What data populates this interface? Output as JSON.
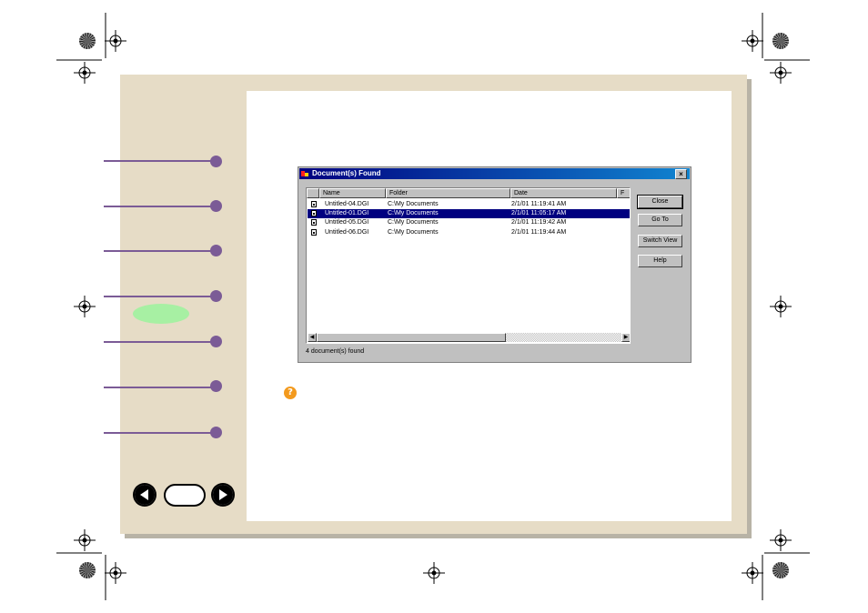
{
  "dialog": {
    "title": "Document(s) Found",
    "close_glyph": "×",
    "columns": [
      "Name",
      "Folder",
      "Date",
      "F"
    ],
    "rows": [
      {
        "name": "Untitled-04.DGI",
        "folder": "C:\\My Documents",
        "date": "2/1/01 11:19:41 AM",
        "selected": false
      },
      {
        "name": "Untitled-01.DGI",
        "folder": "C:\\My Documents",
        "date": "2/1/01 11:05:17 AM",
        "selected": true
      },
      {
        "name": "Untitled-05.DGI",
        "folder": "C:\\My Documents",
        "date": "2/1/01 11:19:42 AM",
        "selected": false
      },
      {
        "name": "Untitled-06.DGI",
        "folder": "C:\\My Documents",
        "date": "2/1/01 11:19:44 AM",
        "selected": false
      }
    ],
    "buttons": {
      "close": "Close",
      "goto": "Go To",
      "switch_view": "Switch View",
      "help": "Help"
    },
    "status": "4 document(s) found"
  },
  "help_icon": {
    "glyph": "?",
    "icon": "question-icon",
    "color": "#f39a1e"
  },
  "colors": {
    "tab_accent": "#7b5b96",
    "active_tab": "#a7f0a3",
    "page_bg": "#e6dcc6",
    "selection": "#000080"
  },
  "nav": {
    "prev_icon": "arrow-left-icon",
    "next_icon": "arrow-right-icon"
  }
}
